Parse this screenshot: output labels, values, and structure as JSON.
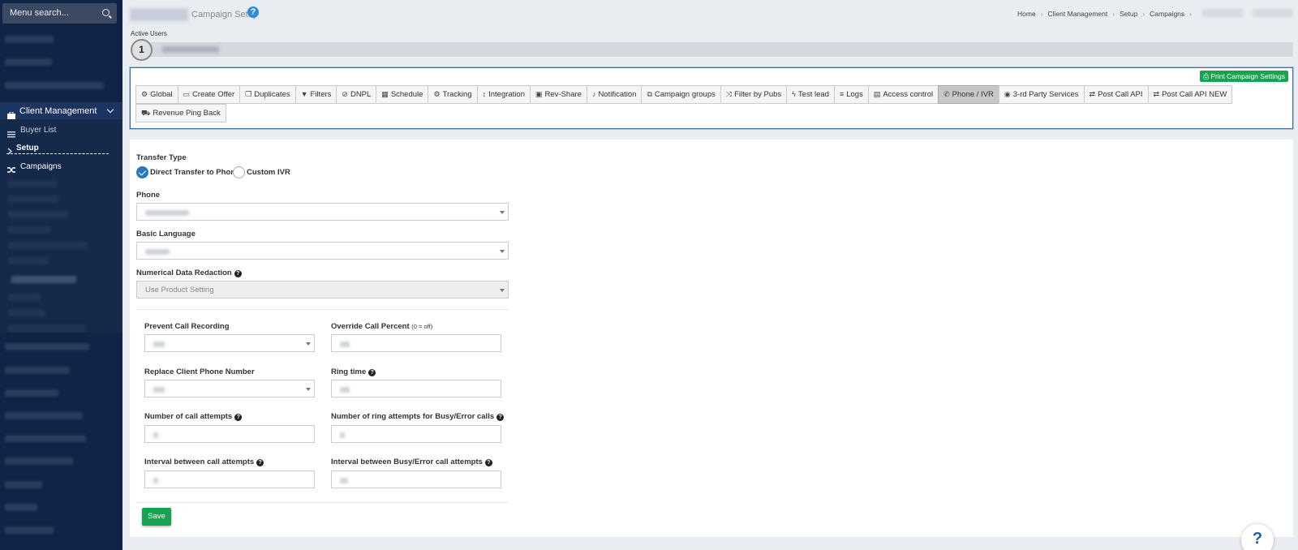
{
  "sidebar": {
    "search_placeholder": "Menu search...",
    "items": {
      "client_management": "Client Management",
      "buyer_list": "Buyer List",
      "setup": "Setup",
      "campaigns": "Campaigns"
    }
  },
  "header": {
    "title": "Campaign Setup",
    "help": "?",
    "breadcrumb": [
      "Home",
      "Client Management",
      "Setup",
      "Campaigns"
    ]
  },
  "active_users": {
    "label": "Active Users",
    "count": "1"
  },
  "toolbar": {
    "print_label": "Print Campaign Settings",
    "tabs": [
      {
        "label": "Global",
        "icon": "cogs-icon",
        "glyph": "⚙"
      },
      {
        "label": "Create Offer",
        "icon": "credit-card-icon",
        "glyph": "▭"
      },
      {
        "label": "Duplicates",
        "icon": "copy-icon",
        "glyph": "❐"
      },
      {
        "label": "Filters",
        "icon": "filter-icon",
        "glyph": "▼"
      },
      {
        "label": "DNPL",
        "icon": "ban-icon",
        "glyph": "⊘"
      },
      {
        "label": "Schedule",
        "icon": "calendar-icon",
        "glyph": "▦"
      },
      {
        "label": "Tracking",
        "icon": "cogs-icon",
        "glyph": "⚙"
      },
      {
        "label": "Integration",
        "icon": "arrows-v-icon",
        "glyph": "↕"
      },
      {
        "label": "Rev-Share",
        "icon": "money-icon",
        "glyph": "▣"
      },
      {
        "label": "Notification",
        "icon": "bell-icon",
        "glyph": "♪"
      },
      {
        "label": "Campaign groups",
        "icon": "object-group-icon",
        "glyph": "⧉"
      },
      {
        "label": "Filter by Pubs",
        "icon": "random-icon",
        "glyph": "⤨"
      },
      {
        "label": "Test lead",
        "icon": "bolt-icon",
        "glyph": "ϟ"
      },
      {
        "label": "Logs",
        "icon": "list-icon",
        "glyph": "≡"
      },
      {
        "label": "Access control",
        "icon": "file-icon",
        "glyph": "▤"
      },
      {
        "label": "Phone / IVR",
        "icon": "phone-icon",
        "glyph": "✆"
      },
      {
        "label": "3-rd Party Services",
        "icon": "eye-icon",
        "glyph": "◉"
      },
      {
        "label": "Post Call API",
        "icon": "exchange-icon",
        "glyph": "⇄"
      },
      {
        "label": "Post Call API NEW",
        "icon": "exchange-icon",
        "glyph": "⇄"
      }
    ],
    "tabs_row2": [
      {
        "label": "Revenue Ping Back",
        "icon": "cart-icon",
        "glyph": "⛟"
      }
    ],
    "active_tab": "Phone / IVR"
  },
  "form": {
    "transfer_type_label": "Transfer Type",
    "transfer_options": [
      "Direct Transfer to Phone",
      "Custom IVR"
    ],
    "transfer_selected": "Direct Transfer to Phone",
    "phone_label": "Phone",
    "basic_language_label": "Basic Language",
    "numerical_label": "Numerical Data Redaction",
    "numerical_value": "Use Product Setting",
    "prevent_recording_label": "Prevent Call Recording",
    "override_percent_label": "Override Call Percent",
    "override_percent_hint": "(0 = off)",
    "replace_phone_label": "Replace Client Phone Number",
    "ring_time_label": "Ring time",
    "call_attempts_label": "Number of call attempts",
    "ring_attempts_label": "Number of ring attempts for Busy/Error calls",
    "interval_label": "Interval between call attempts",
    "interval_busy_label": "Interval between Busy/Error call attempts",
    "save_label": "Save"
  },
  "floating_help": "?",
  "colors": {
    "sidebar": "#0f2447",
    "accent": "#2677bd",
    "green": "#17a351"
  }
}
